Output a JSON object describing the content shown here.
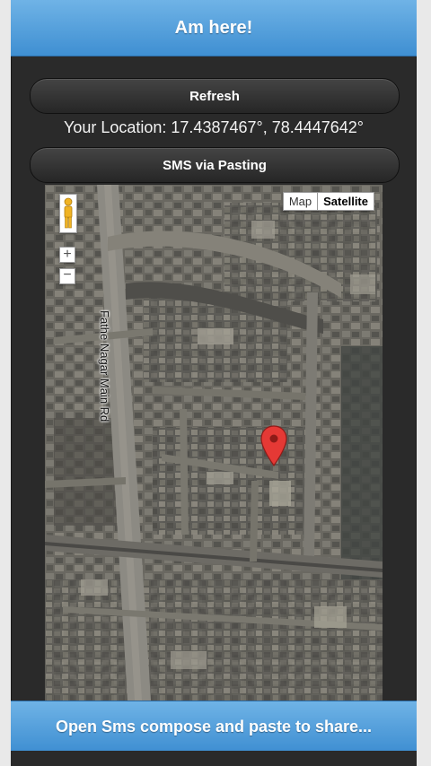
{
  "header": {
    "title": "Am here!"
  },
  "actions": {
    "refresh_label": "Refresh",
    "sms_label": "SMS via Pasting"
  },
  "location": {
    "label": "Your Location:",
    "lat": "17.4387467°",
    "lng": "78.4447642°",
    "text": "Your Location: 17.4387467°, 78.4447642°"
  },
  "map": {
    "map_type_options": [
      "Map",
      "Satellite"
    ],
    "selected_type": "Satellite",
    "road_label": "Fathe Nagar Main Rd",
    "zoom_in": "+",
    "zoom_out": "−",
    "icons": [
      "pegman-icon",
      "location-marker-icon"
    ]
  },
  "footer": {
    "label": "Open Sms compose and paste to share..."
  },
  "colors": {
    "accent": "#4a9ad8",
    "background": "#2a2a2a"
  }
}
